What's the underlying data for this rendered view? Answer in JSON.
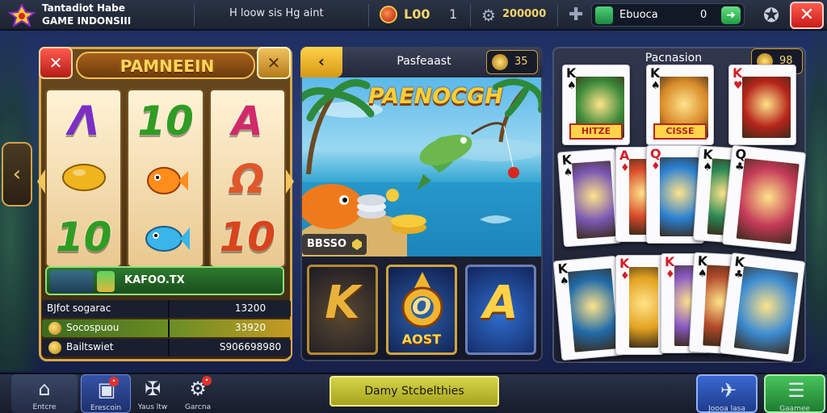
{
  "header": {
    "brand_line1": "Tantadiot Habe",
    "brand_line2": "GAME INDONSIII",
    "title": "H loow sis Hg aint",
    "coins": "L00",
    "coin_level": "1",
    "gems": "200000",
    "wallet_name": "Ebuoca",
    "wallet_value": "0",
    "icons": [
      "game-logo-icon",
      "coin-icon",
      "settings-icon",
      "plus-icon",
      "wallet-icon",
      "wallet-go-icon",
      "favorite-icon",
      "close-icon"
    ]
  },
  "slot": {
    "title": "PAMNEEIN",
    "back_icon": "close-icon",
    "close_icon": "close-icon",
    "reels": [
      [
        {
          "type": "text",
          "value": "Λ",
          "color": "#7b2fc4"
        },
        {
          "type": "icon",
          "value": "lemon-icon",
          "color": "#f0b41e"
        },
        {
          "type": "text",
          "value": "10",
          "color": "#2f9c22"
        }
      ],
      [
        {
          "type": "text",
          "value": "10",
          "color": "#2f9c22"
        },
        {
          "type": "icon",
          "value": "goldfish-icon",
          "color": "#ff8d1c"
        },
        {
          "type": "icon",
          "value": "bluefish-icon",
          "color": "#3ab5e8"
        }
      ],
      [
        {
          "type": "text",
          "value": "A",
          "color": "#d12a6a"
        },
        {
          "type": "text",
          "value": "Ω",
          "color": "#e0572a"
        },
        {
          "type": "text",
          "value": "10",
          "color": "#d8441c"
        }
      ]
    ],
    "player_name": "KAFOO.TX",
    "stats": [
      {
        "label": "BJfot sogarac",
        "value": "13200"
      },
      {
        "label": "Socospuou",
        "value": "33920"
      },
      {
        "label": "Bailtswiet",
        "value": "S906698980"
      }
    ]
  },
  "fishing": {
    "header_title": "Pasfeaast",
    "badge_value": "35",
    "scene_title": "PAENOCGH",
    "score": "BBSSO",
    "tiles": [
      {
        "letter": "K",
        "sub": ""
      },
      {
        "letter": "O",
        "sub": "AOST"
      },
      {
        "letter": "A",
        "sub": ""
      }
    ]
  },
  "cards": {
    "title": "Pacnasion",
    "badge_value": "98",
    "row1": [
      {
        "rank": "K",
        "suit": "♠",
        "color": "black",
        "label": "HITZE"
      },
      {
        "rank": "K",
        "suit": "♠",
        "color": "black",
        "label": "CISSE"
      },
      {
        "rank": "K",
        "suit": "♥",
        "color": "red",
        "label": ""
      }
    ],
    "row2": [
      {
        "rank": "K",
        "suit": "♠",
        "color": "black"
      },
      {
        "rank": "A",
        "suit": "♦",
        "color": "red"
      },
      {
        "rank": "Q",
        "suit": "♦",
        "color": "red"
      },
      {
        "rank": "K",
        "suit": "♠",
        "color": "black"
      },
      {
        "rank": "Q",
        "suit": "♣",
        "color": "black"
      }
    ],
    "row3": [
      {
        "rank": "K",
        "suit": "♠",
        "color": "black"
      },
      {
        "rank": "K",
        "suit": "♦",
        "color": "red"
      },
      {
        "rank": "K",
        "suit": "♦",
        "color": "red"
      },
      {
        "rank": "K",
        "suit": "♠",
        "color": "black"
      },
      {
        "rank": "K",
        "suit": "♣",
        "color": "black"
      }
    ]
  },
  "bottom": {
    "nav": [
      {
        "label": "Entcre",
        "icon": "home-icon",
        "badge": ""
      },
      {
        "label": "Erescoin",
        "icon": "box-icon",
        "badge": "•"
      },
      {
        "label": "Yaus ltw",
        "icon": "tools-icon",
        "badge": ""
      },
      {
        "label": "Garcna",
        "icon": "gear-icon",
        "badge": "•"
      }
    ],
    "center_label": "Damy Stcbelthies",
    "right": [
      {
        "label": "Joooa lasa",
        "icon": "rocket-icon"
      },
      {
        "label": "Gaamee",
        "icon": "menu-icon"
      }
    ]
  },
  "colors": {
    "accent_gold": "#d9a84a",
    "close_red": "#d8261c",
    "go_green": "#2fae4d",
    "background": "#1d2c5c"
  }
}
